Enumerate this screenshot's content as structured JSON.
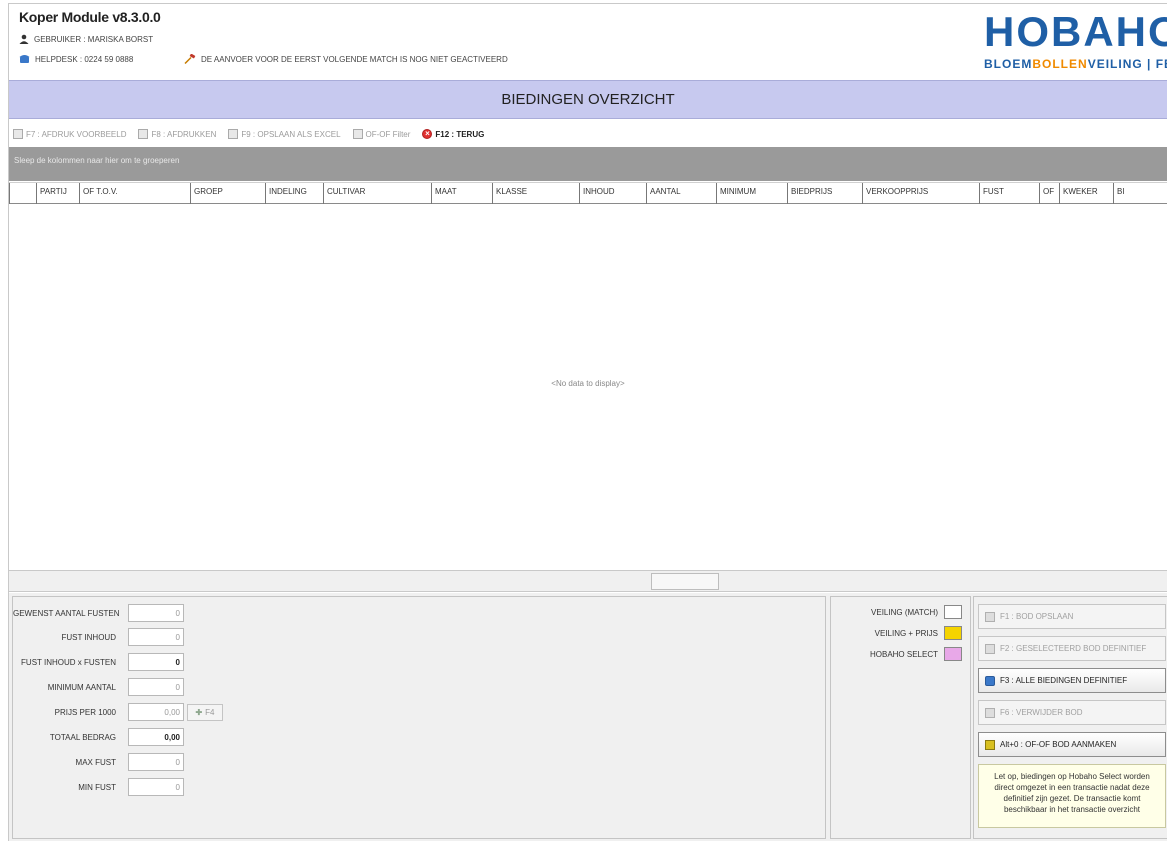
{
  "header": {
    "app_title": "Koper Module v8.3.0.0",
    "user": "GEBRUIKER : MARISKA BORST",
    "helpdesk": "HELPDESK : 0224 59 0888",
    "warning": "DE AANVOER VOOR DE EERST VOLGENDE MATCH IS NOG NIET GEACTIVEERD",
    "logo_letters": "HOBAHO",
    "logo_sub_1": "BLOEM",
    "logo_sub_2": "BOLLEN",
    "logo_sub_3": "VEILING | FBA"
  },
  "page_title": "BIEDINGEN OVERZICHT",
  "toolbar": {
    "print_preview": "F7 : AFDRUK VOORBEELD",
    "print": "F8 : AFDRUKKEN",
    "save_excel": "F9 : OPSLAAN ALS EXCEL",
    "ofof_filter": "OF-OF Filter",
    "back": "F12 : TERUG"
  },
  "grid": {
    "group_hint": "Sleep de kolommen naar hier om te groeperen",
    "columns": [
      "PARTIJ",
      "OF T.O.V.",
      "GROEP",
      "INDELING",
      "CULTIVAR",
      "MAAT",
      "KLASSE",
      "INHOUD",
      "AANTAL",
      "MINIMUM",
      "BIEDPRIJS",
      "VERKOOPPRIJS",
      "FUST",
      "OF",
      "KWEKER",
      "BI"
    ],
    "no_data": "<No data to display>"
  },
  "form": {
    "gewenst_aantal_fusten": {
      "label": "GEWENST AANTAL FUSTEN",
      "value": "0"
    },
    "fust_inhoud": {
      "label": "FUST INHOUD",
      "value": "0"
    },
    "fust_inhoud_x_fusten": {
      "label": "FUST INHOUD x FUSTEN",
      "value": "0"
    },
    "minimum_aantal": {
      "label": "MINIMUM AANTAL",
      "value": "0"
    },
    "prijs_per_1000": {
      "label": "PRIJS PER 1000",
      "value": "0,00"
    },
    "totaal_bedrag": {
      "label": "TOTAAL BEDRAG",
      "value": "0,00"
    },
    "max_fust": {
      "label": "MAX FUST",
      "value": "0"
    },
    "min_fust": {
      "label": "MIN FUST",
      "value": "0"
    },
    "f4_label": "F4"
  },
  "legend": {
    "veiling_match": {
      "label": "VEILING (MATCH)",
      "color": "#ffffff"
    },
    "veiling_prijs": {
      "label": "VEILING + PRIJS",
      "color": "#f5d400"
    },
    "hobaho_select": {
      "label": "HOBAHO SELECT",
      "color": "#e8a8e8"
    }
  },
  "actions": {
    "f1": "F1 : BOD OPSLAAN",
    "f2": "F2 : GESELECTEERD BOD DEFINITIEF",
    "f3": "F3 : ALLE BIEDINGEN DEFINITIEF",
    "f6": "F6 : VERWIJDER BOD",
    "alt0": "Alt+0 : OF-OF BOD AANMAKEN",
    "notice": "Let op, biedingen op Hobaho Select worden direct omgezet in een transactie nadat deze definitief zijn gezet. De transactie komt beschikbaar in het transactie overzicht"
  }
}
